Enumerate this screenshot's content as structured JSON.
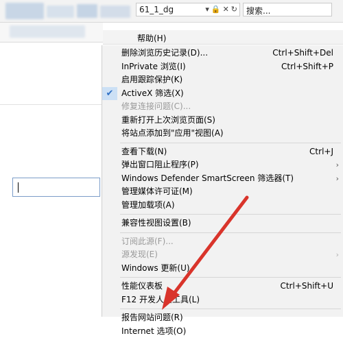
{
  "colors": {
    "arrow": "#d9342b",
    "check_bg": "#cce0f5",
    "check": "#2e6fc4",
    "menu_bg": "#f2f2f2"
  },
  "address": {
    "text": "61_1_dg",
    "icons": [
      "dropdown-icon",
      "lock-icon",
      "refresh-icon"
    ]
  },
  "search": {
    "label": "搜索..."
  },
  "help_label": "帮助(H)",
  "menu": {
    "groups": [
      [
        {
          "name": "delete-history",
          "label": "删除浏览历史记录(D)...",
          "shortcut": "Ctrl+Shift+Del"
        },
        {
          "name": "inprivate",
          "label": "InPrivate 浏览(I)",
          "shortcut": "Ctrl+Shift+P"
        },
        {
          "name": "tracking-protection",
          "label": "启用跟踪保护(K)",
          "shortcut": ""
        },
        {
          "name": "activex-filter",
          "label": "ActiveX 筛选(X)",
          "shortcut": "",
          "checked": true
        },
        {
          "name": "fix-connection",
          "label": "修复连接问题(C)...",
          "shortcut": "",
          "disabled": true
        },
        {
          "name": "reopen-session",
          "label": "重新打开上次浏览页面(S)",
          "shortcut": ""
        },
        {
          "name": "add-to-apps",
          "label": "将站点添加到\"应用\"视图(A)",
          "shortcut": ""
        }
      ],
      [
        {
          "name": "view-downloads",
          "label": "查看下载(N)",
          "shortcut": "Ctrl+J"
        },
        {
          "name": "popup-blocker",
          "label": "弹出窗口阻止程序(P)",
          "shortcut": "",
          "submenu": true
        },
        {
          "name": "smartscreen",
          "label": "Windows Defender SmartScreen 筛选器(T)",
          "shortcut": "",
          "submenu": true
        },
        {
          "name": "media-license",
          "label": "管理媒体许可证(M)",
          "shortcut": ""
        },
        {
          "name": "manage-addons",
          "label": "管理加载项(A)",
          "shortcut": ""
        }
      ],
      [
        {
          "name": "compat-view",
          "label": "兼容性视图设置(B)",
          "shortcut": ""
        }
      ],
      [
        {
          "name": "subscribe-feed",
          "label": "订阅此源(F)...",
          "shortcut": "",
          "disabled": true
        },
        {
          "name": "feed-discovery",
          "label": "源发现(E)",
          "shortcut": "",
          "disabled": true,
          "submenu": true
        },
        {
          "name": "windows-update",
          "label": "Windows 更新(U)",
          "shortcut": ""
        }
      ],
      [
        {
          "name": "perf-dashboard",
          "label": "性能仪表板",
          "shortcut": "Ctrl+Shift+U"
        },
        {
          "name": "f12-devtools",
          "label": "F12 开发人员工具(L)",
          "shortcut": ""
        }
      ],
      [
        {
          "name": "report-site",
          "label": "报告网站问题(R)",
          "shortcut": ""
        },
        {
          "name": "internet-options",
          "label": "Internet 选项(O)",
          "shortcut": ""
        }
      ]
    ]
  }
}
